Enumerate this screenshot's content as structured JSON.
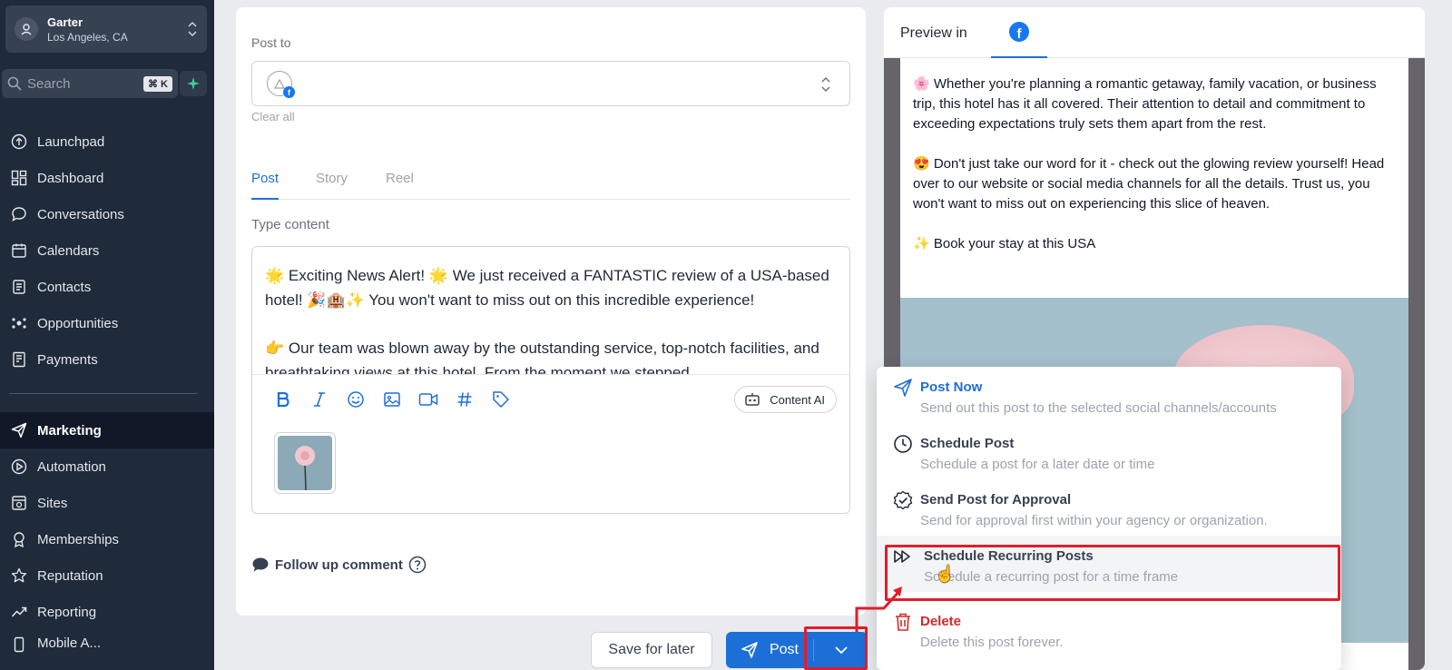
{
  "sidebar": {
    "account": {
      "name": "Garter",
      "location": "Los Angeles, CA"
    },
    "search": {
      "placeholder": "Search",
      "shortcut": "⌘ K"
    },
    "items": [
      {
        "label": "Launchpad",
        "icon": "rocket-icon"
      },
      {
        "label": "Dashboard",
        "icon": "dashboard-icon"
      },
      {
        "label": "Conversations",
        "icon": "chat-icon"
      },
      {
        "label": "Calendars",
        "icon": "calendar-icon"
      },
      {
        "label": "Contacts",
        "icon": "contacts-icon"
      },
      {
        "label": "Opportunities",
        "icon": "opportunities-icon"
      },
      {
        "label": "Payments",
        "icon": "payments-icon"
      },
      {
        "label": "Marketing",
        "icon": "send-icon",
        "active": true
      },
      {
        "label": "Automation",
        "icon": "automation-icon"
      },
      {
        "label": "Sites",
        "icon": "sites-icon"
      },
      {
        "label": "Memberships",
        "icon": "memberships-icon"
      },
      {
        "label": "Reputation",
        "icon": "star-icon"
      },
      {
        "label": "Reporting",
        "icon": "trend-icon"
      },
      {
        "label": "Mobile A...",
        "icon": "mobile-icon"
      }
    ]
  },
  "compose": {
    "post_to_label": "Post to",
    "clear_all": "Clear all",
    "tabs": [
      "Post",
      "Story",
      "Reel"
    ],
    "active_tab": "Post",
    "type_content_label": "Type content",
    "content_lines": [
      "🌟 Exciting News Alert! 🌟 We just received a FANTASTIC review of a USA-based hotel! 🎉🏨✨ You won't want to miss out on this incredible experience!",
      "👉 Our team was blown away by the outstanding service, top-notch facilities, and breathtaking views at this hotel. From the moment we stepped..."
    ],
    "content_ai_label": "Content AI",
    "follow_up_label": "Follow up comment"
  },
  "buttons": {
    "save_for_later": "Save for later",
    "post": "Post"
  },
  "preview": {
    "title": "Preview in",
    "network": "facebook",
    "paragraphs": [
      "🌸 Whether you're planning a romantic getaway, family vacation, or business trip, this hotel has it all covered. Their attention to detail and commitment to exceeding expectations truly sets them apart from the rest.",
      "😍 Don't just take our word for it - check out the glowing review yourself! Head over to our website or social media channels for all the details. Trust us, you won't want to miss out on experiencing this slice of heaven.",
      "✨ Book your stay at this USA"
    ]
  },
  "menu": {
    "items": [
      {
        "title": "Post Now",
        "desc": "Send out this post to the selected social channels/accounts"
      },
      {
        "title": "Schedule Post",
        "desc": "Schedule a post for a later date or time"
      },
      {
        "title": "Send Post for Approval",
        "desc": "Send for approval first within your agency or organization."
      },
      {
        "title": "Schedule Recurring Posts",
        "desc": "Schedule a recurring post for a time frame"
      },
      {
        "title": "Delete",
        "desc": "Delete this post forever."
      }
    ]
  },
  "colors": {
    "accent": "#1d6fd8",
    "highlight": "#e11d2a",
    "sidebar": "#1f2a3a",
    "danger": "#dc2626"
  }
}
